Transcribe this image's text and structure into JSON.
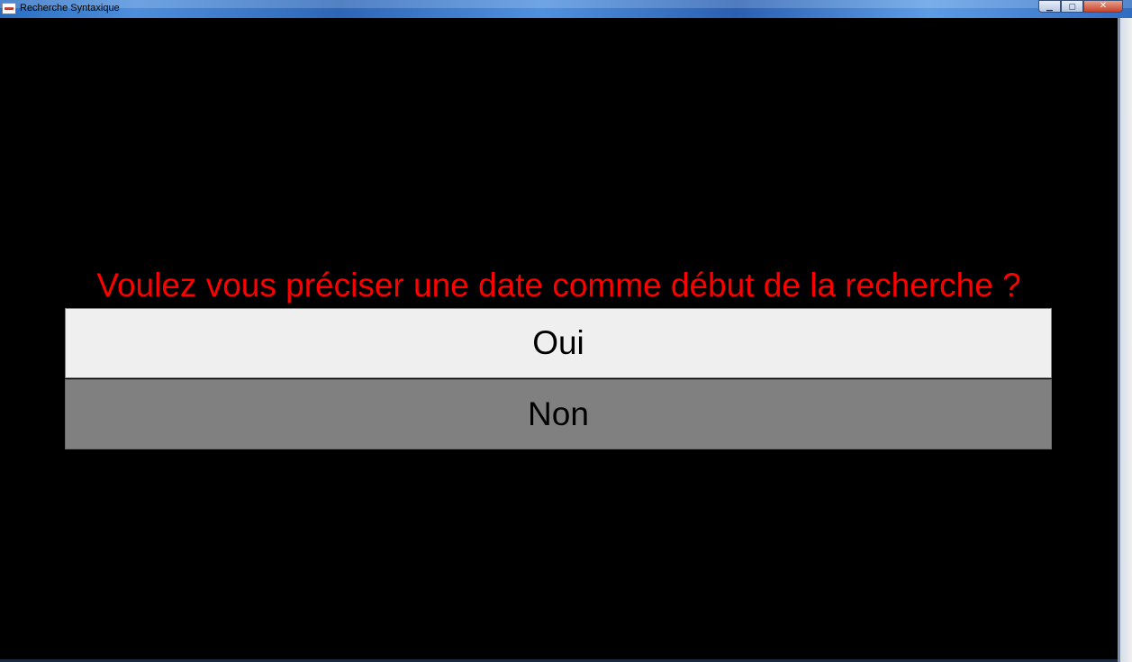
{
  "window": {
    "title": "Recherche Syntaxique",
    "minimize_glyph": "▁",
    "maximize_glyph": "▢",
    "close_glyph": "✕"
  },
  "dialog": {
    "question": "Voulez vous préciser une date comme début de la recherche ?",
    "options": [
      {
        "label": "Oui",
        "selected": true
      },
      {
        "label": "Non",
        "selected": false
      }
    ]
  },
  "colors": {
    "background": "#000000",
    "question_text": "#ff0000",
    "selected_option_bg": "#efefef",
    "unselected_option_bg": "#808080"
  }
}
